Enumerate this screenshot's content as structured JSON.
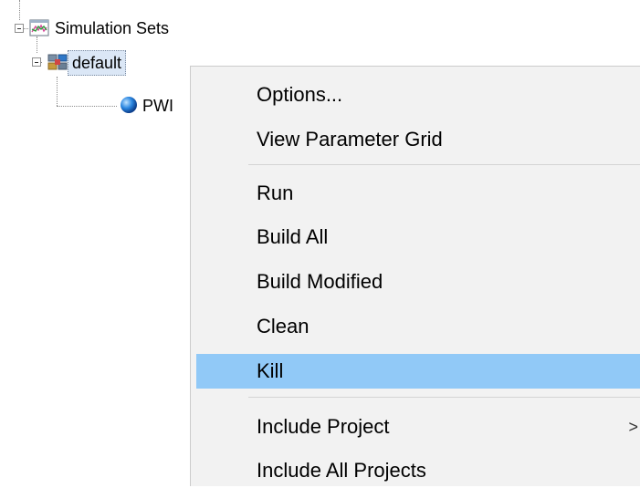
{
  "tree": {
    "root": {
      "label": "Simulation Sets",
      "icon": "simulation-sets-icon",
      "expanded": true
    },
    "child": {
      "label": "default",
      "icon": "simulation-set-icon",
      "expanded": true,
      "selected": true
    },
    "grandchild": {
      "label": "PWI",
      "icon": "blue-sphere-icon"
    }
  },
  "context_menu": {
    "items": [
      {
        "label": "Options..."
      },
      {
        "label": "View Parameter Grid"
      },
      {
        "label": "Run"
      },
      {
        "label": "Build All"
      },
      {
        "label": "Build Modified"
      },
      {
        "label": "Clean"
      },
      {
        "label": "Kill",
        "highlighted": true
      },
      {
        "label": "Include Project",
        "submenu_arrow": ">"
      },
      {
        "label": "Include All Projects"
      }
    ]
  },
  "colors": {
    "menu_background": "#f2f2f2",
    "highlight": "#91c9f7",
    "selection": "#dbe7f6"
  }
}
